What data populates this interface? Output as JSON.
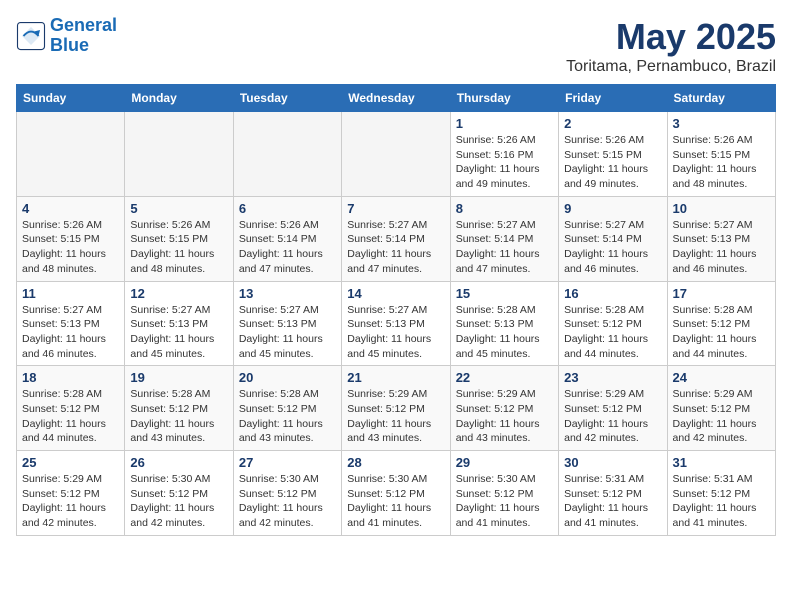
{
  "logo": {
    "line1": "General",
    "line2": "Blue"
  },
  "title": "May 2025",
  "subtitle": "Toritama, Pernambuco, Brazil",
  "days_of_week": [
    "Sunday",
    "Monday",
    "Tuesday",
    "Wednesday",
    "Thursday",
    "Friday",
    "Saturday"
  ],
  "weeks": [
    [
      {
        "num": "",
        "info": ""
      },
      {
        "num": "",
        "info": ""
      },
      {
        "num": "",
        "info": ""
      },
      {
        "num": "",
        "info": ""
      },
      {
        "num": "1",
        "info": "Sunrise: 5:26 AM\nSunset: 5:16 PM\nDaylight: 11 hours\nand 49 minutes."
      },
      {
        "num": "2",
        "info": "Sunrise: 5:26 AM\nSunset: 5:15 PM\nDaylight: 11 hours\nand 49 minutes."
      },
      {
        "num": "3",
        "info": "Sunrise: 5:26 AM\nSunset: 5:15 PM\nDaylight: 11 hours\nand 48 minutes."
      }
    ],
    [
      {
        "num": "4",
        "info": "Sunrise: 5:26 AM\nSunset: 5:15 PM\nDaylight: 11 hours\nand 48 minutes."
      },
      {
        "num": "5",
        "info": "Sunrise: 5:26 AM\nSunset: 5:15 PM\nDaylight: 11 hours\nand 48 minutes."
      },
      {
        "num": "6",
        "info": "Sunrise: 5:26 AM\nSunset: 5:14 PM\nDaylight: 11 hours\nand 47 minutes."
      },
      {
        "num": "7",
        "info": "Sunrise: 5:27 AM\nSunset: 5:14 PM\nDaylight: 11 hours\nand 47 minutes."
      },
      {
        "num": "8",
        "info": "Sunrise: 5:27 AM\nSunset: 5:14 PM\nDaylight: 11 hours\nand 47 minutes."
      },
      {
        "num": "9",
        "info": "Sunrise: 5:27 AM\nSunset: 5:14 PM\nDaylight: 11 hours\nand 46 minutes."
      },
      {
        "num": "10",
        "info": "Sunrise: 5:27 AM\nSunset: 5:13 PM\nDaylight: 11 hours\nand 46 minutes."
      }
    ],
    [
      {
        "num": "11",
        "info": "Sunrise: 5:27 AM\nSunset: 5:13 PM\nDaylight: 11 hours\nand 46 minutes."
      },
      {
        "num": "12",
        "info": "Sunrise: 5:27 AM\nSunset: 5:13 PM\nDaylight: 11 hours\nand 45 minutes."
      },
      {
        "num": "13",
        "info": "Sunrise: 5:27 AM\nSunset: 5:13 PM\nDaylight: 11 hours\nand 45 minutes."
      },
      {
        "num": "14",
        "info": "Sunrise: 5:27 AM\nSunset: 5:13 PM\nDaylight: 11 hours\nand 45 minutes."
      },
      {
        "num": "15",
        "info": "Sunrise: 5:28 AM\nSunset: 5:13 PM\nDaylight: 11 hours\nand 45 minutes."
      },
      {
        "num": "16",
        "info": "Sunrise: 5:28 AM\nSunset: 5:12 PM\nDaylight: 11 hours\nand 44 minutes."
      },
      {
        "num": "17",
        "info": "Sunrise: 5:28 AM\nSunset: 5:12 PM\nDaylight: 11 hours\nand 44 minutes."
      }
    ],
    [
      {
        "num": "18",
        "info": "Sunrise: 5:28 AM\nSunset: 5:12 PM\nDaylight: 11 hours\nand 44 minutes."
      },
      {
        "num": "19",
        "info": "Sunrise: 5:28 AM\nSunset: 5:12 PM\nDaylight: 11 hours\nand 43 minutes."
      },
      {
        "num": "20",
        "info": "Sunrise: 5:28 AM\nSunset: 5:12 PM\nDaylight: 11 hours\nand 43 minutes."
      },
      {
        "num": "21",
        "info": "Sunrise: 5:29 AM\nSunset: 5:12 PM\nDaylight: 11 hours\nand 43 minutes."
      },
      {
        "num": "22",
        "info": "Sunrise: 5:29 AM\nSunset: 5:12 PM\nDaylight: 11 hours\nand 43 minutes."
      },
      {
        "num": "23",
        "info": "Sunrise: 5:29 AM\nSunset: 5:12 PM\nDaylight: 11 hours\nand 42 minutes."
      },
      {
        "num": "24",
        "info": "Sunrise: 5:29 AM\nSunset: 5:12 PM\nDaylight: 11 hours\nand 42 minutes."
      }
    ],
    [
      {
        "num": "25",
        "info": "Sunrise: 5:29 AM\nSunset: 5:12 PM\nDaylight: 11 hours\nand 42 minutes."
      },
      {
        "num": "26",
        "info": "Sunrise: 5:30 AM\nSunset: 5:12 PM\nDaylight: 11 hours\nand 42 minutes."
      },
      {
        "num": "27",
        "info": "Sunrise: 5:30 AM\nSunset: 5:12 PM\nDaylight: 11 hours\nand 42 minutes."
      },
      {
        "num": "28",
        "info": "Sunrise: 5:30 AM\nSunset: 5:12 PM\nDaylight: 11 hours\nand 41 minutes."
      },
      {
        "num": "29",
        "info": "Sunrise: 5:30 AM\nSunset: 5:12 PM\nDaylight: 11 hours\nand 41 minutes."
      },
      {
        "num": "30",
        "info": "Sunrise: 5:31 AM\nSunset: 5:12 PM\nDaylight: 11 hours\nand 41 minutes."
      },
      {
        "num": "31",
        "info": "Sunrise: 5:31 AM\nSunset: 5:12 PM\nDaylight: 11 hours\nand 41 minutes."
      }
    ]
  ]
}
